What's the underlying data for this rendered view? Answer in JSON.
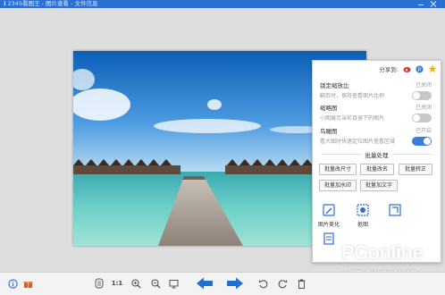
{
  "window": {
    "title": "ℹ 2345看图王 - 图片查看 - 文件信息"
  },
  "panel": {
    "share_label": "分享到:",
    "share_icons": [
      "weibo-icon",
      "qzone-icon",
      "favorite-star-icon"
    ],
    "settings": [
      {
        "title": "锁定缩放比",
        "desc": "翻页时，保持查看图片比例",
        "status": "已关闭",
        "enabled": false
      },
      {
        "title": "缩略图",
        "desc": "小图展示当前目录下的图片",
        "status": "已关闭",
        "enabled": false
      },
      {
        "title": "鸟瞰图",
        "desc": "看大图时快速定位图片查看区域",
        "status": "已开启",
        "enabled": true
      }
    ],
    "batch_title": "批量处理",
    "batch_buttons": [
      "批量改尺寸",
      "批量改名",
      "批量转正",
      "批量加水印",
      "批量加文字"
    ],
    "tools": [
      {
        "label": "图片美化",
        "icon": "pencil-icon"
      },
      {
        "label": "抠图",
        "icon": "cutout-icon"
      },
      {
        "label": "",
        "icon": "crop-icon"
      },
      {
        "label": "",
        "icon": "document-icon"
      }
    ]
  },
  "toolbar": {
    "ratio_label": "1:1",
    "icons": [
      "info-icon",
      "gift-icon",
      "fit-window-icon",
      "actual-size-icon",
      "zoom-in-icon",
      "zoom-out-icon",
      "slideshow-icon",
      "previous-arrow-icon",
      "next-arrow-icon",
      "rotate-left-icon",
      "rotate-right-icon",
      "delete-icon"
    ]
  },
  "watermark": {
    "brand": "PConline",
    "chinese": "太平洋电脑网"
  },
  "colors": {
    "title_bar": "#2b6fd1",
    "accent": "#3d7be0",
    "arrow_blue": "#1f6fd6",
    "panel_bg": "#ffffff"
  }
}
